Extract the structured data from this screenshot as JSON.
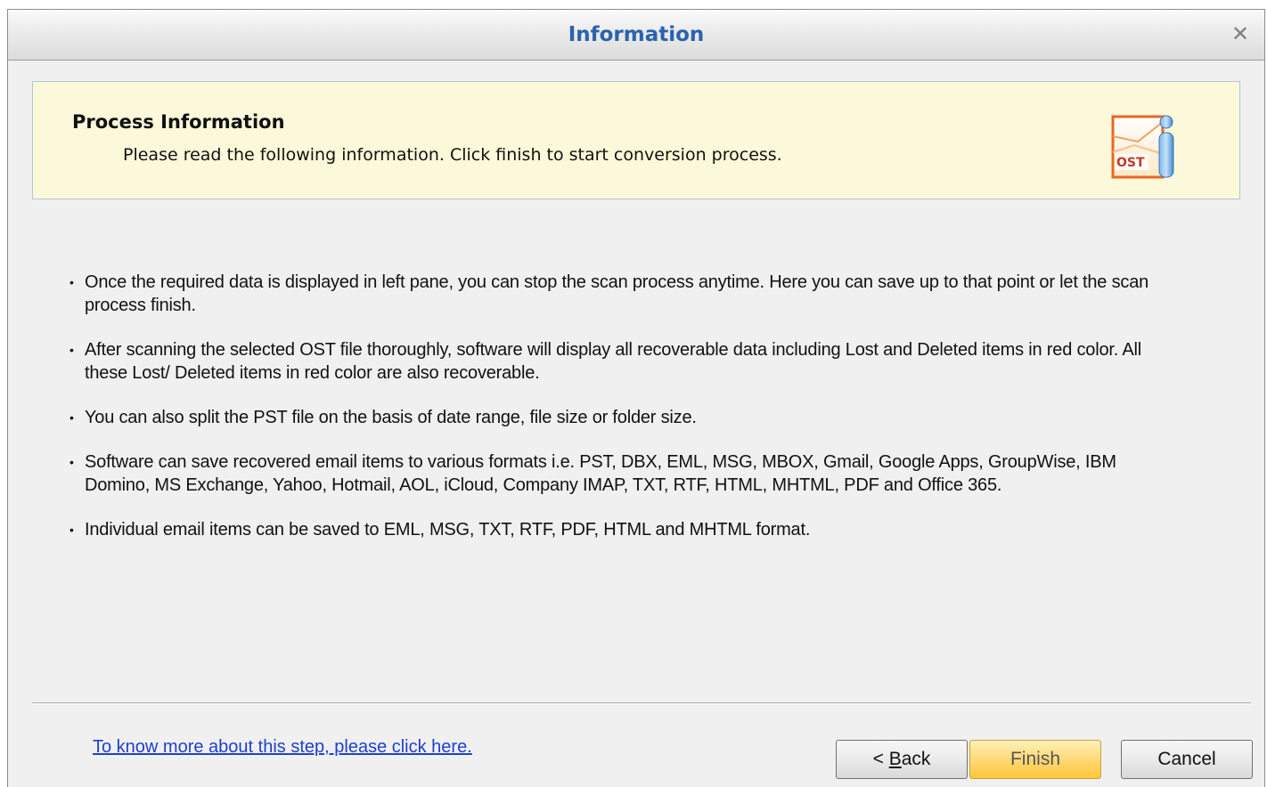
{
  "window": {
    "title": "Information",
    "close_glyph": "✕"
  },
  "banner": {
    "heading": "Process Information",
    "subtitle": "Please read the following information. Click finish to start conversion process.",
    "icon": "ost-info-icon",
    "icon_text": "OST"
  },
  "info_items": [
    "Once the required data is displayed in left pane, you can stop the scan process anytime. Here you can save up to that point or let the scan process finish.",
    "After scanning the selected OST file thoroughly, software will display all recoverable data including Lost and Deleted items in red color. All these Lost/ Deleted items in red color are also recoverable.",
    "You can also split the PST file on the basis of date range, file size or folder size.",
    "Software can save recovered email items to various formats i.e. PST, DBX, EML, MSG, MBOX, Gmail, Google Apps, GroupWise, IBM Domino, MS Exchange, Yahoo, Hotmail, AOL, iCloud, Company IMAP, TXT, RTF, HTML, MHTML, PDF and Office 365.",
    "Individual email items can be saved to EML, MSG, TXT, RTF, PDF, HTML and MHTML format."
  ],
  "footer": {
    "help_link": "To know more about this step, please click here.",
    "back_prefix": "< ",
    "back_mnemonic": "B",
    "back_suffix": "ack",
    "finish_label": "Finish",
    "cancel_label": "Cancel"
  },
  "colors": {
    "title": "#2a63ad",
    "banner_bg": "#fbf9d9",
    "link": "#1f3fcf",
    "finish_button": "#ffd978"
  }
}
